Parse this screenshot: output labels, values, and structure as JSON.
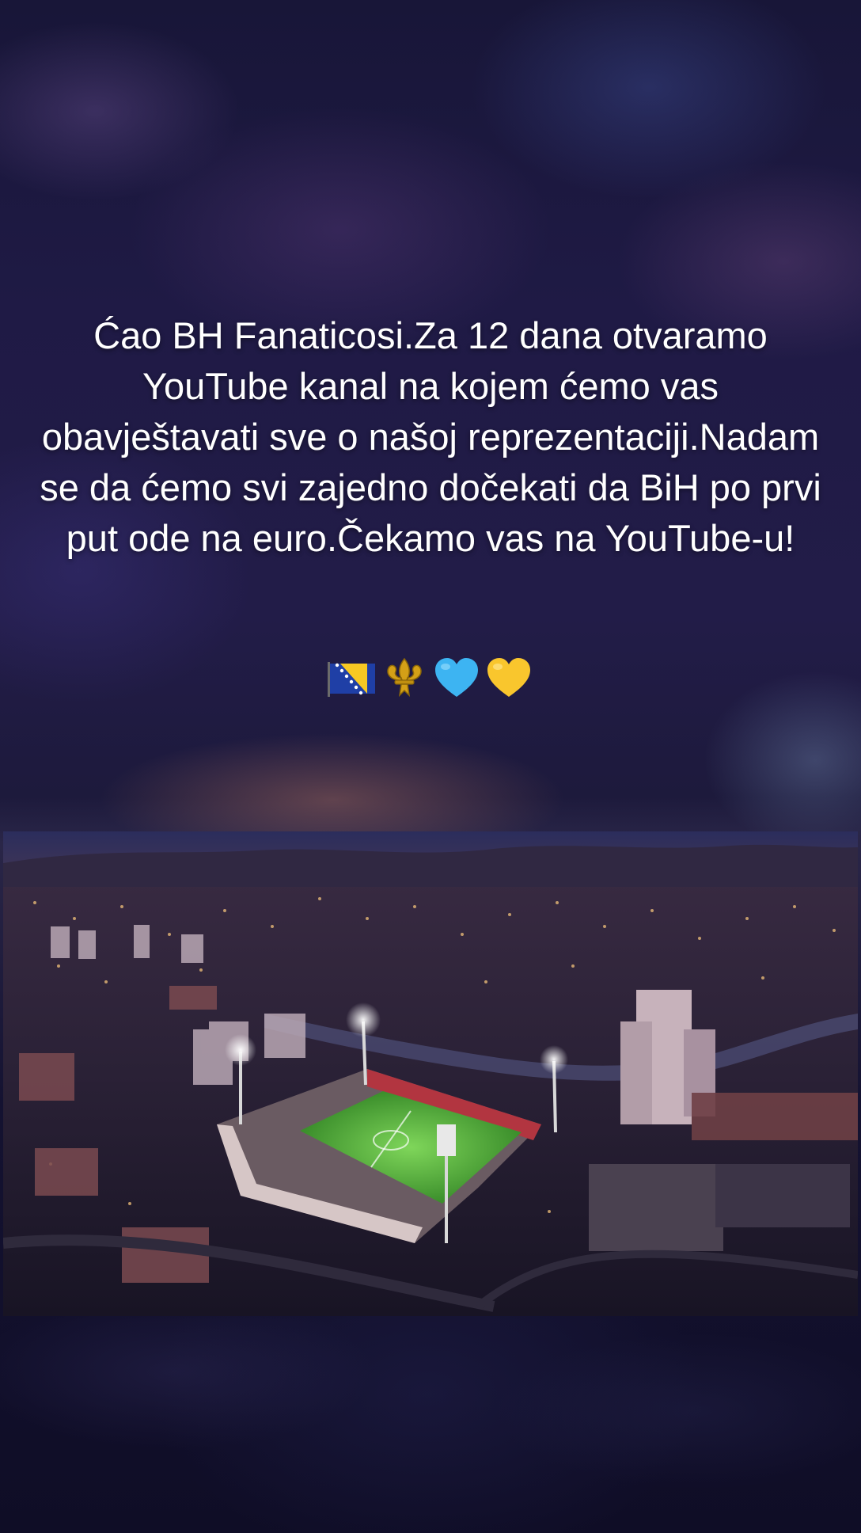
{
  "post": {
    "caption": "Ćao BH Fanaticosi.Za 12 dana otvaramo YouTube kanal na kojem ćemo vas obavještavati sve o našoj reprezentaciji.Nadam se da ćemo svi zajedno dočekati da BiH po prvi put ode na euro.Čekamo vas na YouTube-u!",
    "emojis": [
      "bosnia-flag",
      "fleur-de-lis",
      "blue-heart",
      "yellow-heart"
    ]
  },
  "image": {
    "subject": "stadium-night-aerial"
  },
  "colors": {
    "background": "#1d1a3c",
    "pitch": "#4fa83a",
    "flag_blue": "#1f3fa6",
    "flag_yellow": "#f7c823",
    "heart_blue": "#3db4f2",
    "heart_yellow": "#f9c62d"
  }
}
